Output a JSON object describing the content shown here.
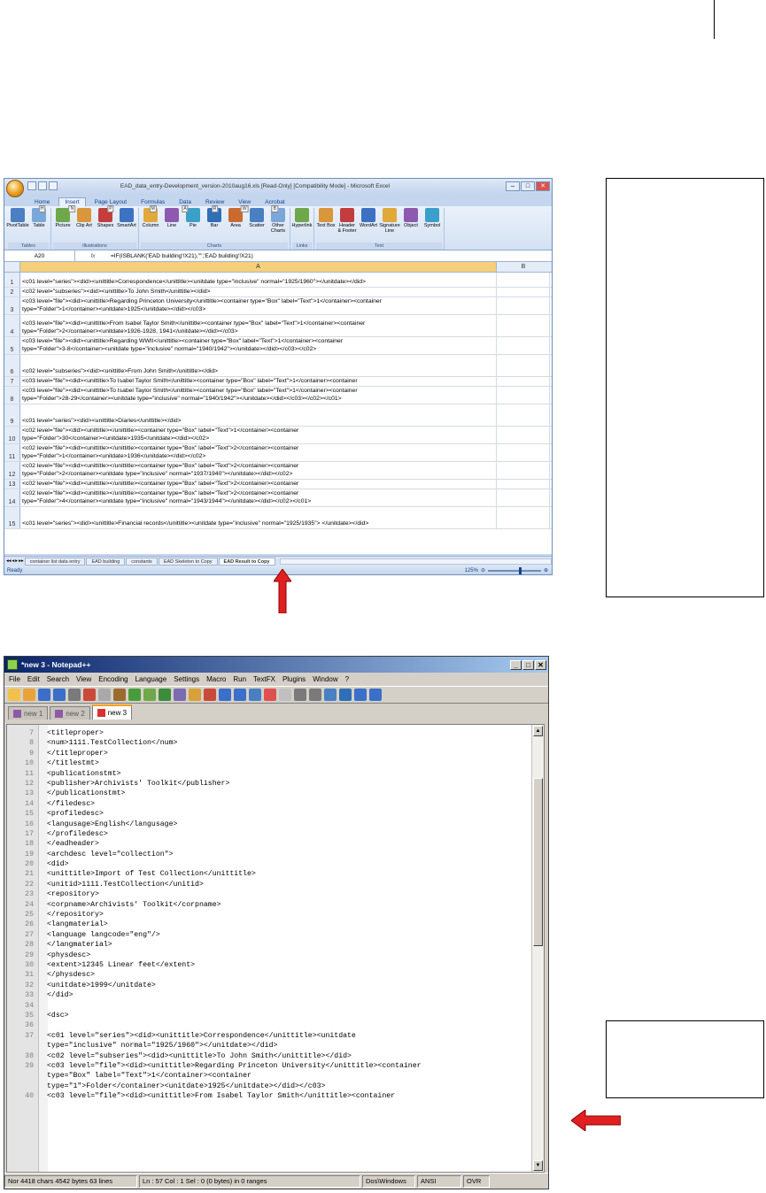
{
  "excel": {
    "window_title": "EAD_data_entry-Development_version-2010aug16.xls [Read-Only] [Compatibility Mode] - Microsoft Excel",
    "tabs": [
      {
        "label": "Home",
        "key": "H"
      },
      {
        "label": "Insert",
        "key": "N"
      },
      {
        "label": "Page Layout",
        "key": "P"
      },
      {
        "label": "Formulas",
        "key": "M"
      },
      {
        "label": "Data",
        "key": "A"
      },
      {
        "label": "Review",
        "key": "R"
      },
      {
        "label": "View",
        "key": "W"
      },
      {
        "label": "Acrobat",
        "key": "B"
      }
    ],
    "ribbon_groups": [
      {
        "label": "Tables",
        "items": [
          "PivotTable",
          "Table"
        ]
      },
      {
        "label": "Illustrations",
        "items": [
          "Picture",
          "Clip Art",
          "Shapes",
          "SmartArt"
        ]
      },
      {
        "label": "Charts",
        "items": [
          "Column",
          "Line",
          "Pie",
          "Bar",
          "Area",
          "Scatter",
          "Other Charts"
        ]
      },
      {
        "label": "Links",
        "items": [
          "Hyperlink"
        ]
      },
      {
        "label": "Text",
        "items": [
          "Text Box",
          "Header & Footer",
          "WordArt",
          "Signature Line",
          "Object",
          "Symbol"
        ]
      }
    ],
    "name_box": "A20",
    "formula": "=IF(ISBLANK('EAD building'!X21),\"\",'EAD building'!X21)",
    "col_a": "A",
    "col_b": "B",
    "rows": [
      {
        "n": "1",
        "text": "<c01 level=\"series\"><did><unittitle>Correspondence</unittitle><unitdate type=\"inclusive\" normal=\"1925/1960\"></unitdate></did>"
      },
      {
        "n": "2",
        "text": "<c02 level=\"subseries\"><did><unittitle>To John Smith</unittitle></did>"
      },
      {
        "n": "3",
        "text": "<c03 level=\"file\"><did><unittitle>Regarding Princeton University</unittitle><container type=\"Box\" label=\"Text\">1</container><container\ntype=\"Folder\">1</container><unitdate>1925</unitdate></did></c03>"
      },
      {
        "n": "4",
        "text": "<c03 level=\"file\"><did><unittitle>From Isabel Taylor Smith</unittitle><container type=\"Box\" label=\"Text\">1</container><container\ntype=\"Folder\">2</container><unitdate>1926-1928, 1941</unitdate></did></c03>"
      },
      {
        "n": "5",
        "text": "<c03 level=\"file\"><did><unittitle>Regarding WWII</unittitle><container type=\"Box\" label=\"Text\">1</container><container\ntype=\"Folder\">3-8</container><unitdate type=\"inclusive\" normal=\"1940/1942\"></unitdate></did></c03></c02>"
      },
      {
        "n": "6",
        "text": "<c02 level=\"subseries\"><did><unittitle>From John Smith</unittitle></did>"
      },
      {
        "n": "7",
        "text": "<c03 level=\"file\"><did><unittitle>To Isabel Taylor Smith</unittitle><container type=\"Box\" label=\"Text\">1</container><container"
      },
      {
        "n": "8",
        "text": "<c03 level=\"file\"><did><unittitle>To Isabel Taylor Smith</unittitle><container type=\"Box\" label=\"Text\">1</container><container\ntype=\"Folder\">28-29</container><unitdate type=\"inclusive\" normal=\"1940/1942\"></unitdate></did></c03></c02></c01>"
      },
      {
        "n": "9",
        "text": "<c01 level=\"series\"><did><unittitle>Diaries</unittitle></did>"
      },
      {
        "n": "10",
        "text": "<c02 level=\"file\"><did><unittitle></unittitle><container type=\"Box\" label=\"Text\">1</container><container\ntype=\"Folder\">30</container><unitdate>1935</unitdate></did></c02>"
      },
      {
        "n": "11",
        "text": "<c02 level=\"file\"><did><unittitle></unittitle><container type=\"Box\" label=\"Text\">2</container><container\ntype=\"Folder\">1</container><unitdate>1936</unitdate></did></c02>"
      },
      {
        "n": "12",
        "text": "<c02 level=\"file\"><did><unittitle></unittitle><container type=\"Box\" label=\"Text\">2</container><container\ntype=\"Folder\">2</container><unitdate type=\"inclusive\" normal=\"1937/1940\"></unitdate></did></c02>"
      },
      {
        "n": "13",
        "text": "<c02 level=\"file\"><did><unittitle></unittitle><container type=\"Box\" label=\"Text\">2</container><container"
      },
      {
        "n": "14",
        "text": "<c02 level=\"file\"><did><unittitle></unittitle><container type=\"Box\" label=\"Text\">2</container><container\ntype=\"Folder\">4</container><unitdate type=\"inclusive\" normal=\"1943/1944\"></unitdate></did></c02></c01>"
      },
      {
        "n": "15",
        "text": "<c01 level=\"series\"><did><unittitle>Financial records</unittitle><unitdate type=\"inclusive\" normal=\"1925/1935\"> </unitdate></did>"
      }
    ],
    "sheets": [
      "container list data entry",
      "EAD building",
      "constants",
      "EAD Skeleton to Copy",
      "EAD Result to Copy"
    ],
    "status": "Ready",
    "zoom": "125%"
  },
  "npp": {
    "title": "*new 3 - Notepad++",
    "menu": [
      "File",
      "Edit",
      "Search",
      "View",
      "Encoding",
      "Language",
      "Settings",
      "Macro",
      "Run",
      "TextFX",
      "Plugins",
      "Window",
      "?"
    ],
    "tabs": [
      "new 1",
      "new 2",
      "new 3"
    ],
    "lines": [
      {
        "n": "7",
        "code": "<titleproper>"
      },
      {
        "n": "8",
        "code": "<num>1111.TestCollection</num>"
      },
      {
        "n": "9",
        "code": "</titleproper>"
      },
      {
        "n": "10",
        "code": "</titlestmt>"
      },
      {
        "n": "11",
        "code": "<publicationstmt>"
      },
      {
        "n": "12",
        "code": "<publisher>Archivists' Toolkit</publisher>"
      },
      {
        "n": "13",
        "code": "</publicationstmt>"
      },
      {
        "n": "14",
        "code": "</filedesc>"
      },
      {
        "n": "15",
        "code": "<profiledesc>"
      },
      {
        "n": "16",
        "code": "<langusage>English</langusage>"
      },
      {
        "n": "17",
        "code": "</profiledesc>"
      },
      {
        "n": "18",
        "code": "</eadheader>"
      },
      {
        "n": "19",
        "code": "<archdesc level=\"collection\">"
      },
      {
        "n": "20",
        "code": "<did>"
      },
      {
        "n": "21",
        "code": "<unittitle>Import of Test Collection</unittitle>"
      },
      {
        "n": "22",
        "code": "<unitid>1111.TestCollection</unitid>"
      },
      {
        "n": "23",
        "code": "<repository>"
      },
      {
        "n": "24",
        "code": "<corpname>Archivists' Toolkit</corpname>"
      },
      {
        "n": "25",
        "code": "</repository>"
      },
      {
        "n": "26",
        "code": "<langmaterial>"
      },
      {
        "n": "27",
        "code": "<language langcode=\"eng\"/>"
      },
      {
        "n": "28",
        "code": "</langmaterial>"
      },
      {
        "n": "29",
        "code": "<physdesc>"
      },
      {
        "n": "30",
        "code": "<extent>12345 Linear feet</extent>"
      },
      {
        "n": "31",
        "code": "</physdesc>"
      },
      {
        "n": "32",
        "code": "<unitdate>1999</unitdate>"
      },
      {
        "n": "33",
        "code": "</did>"
      },
      {
        "n": "34",
        "code": ""
      },
      {
        "n": "35",
        "code": "<dsc>"
      },
      {
        "n": "36",
        "code": ""
      },
      {
        "n": "37",
        "code": "<c01 level=\"series\"><did><unittitle>Correspondence</unittitle><unitdate"
      },
      {
        "n": "",
        "code": "type=\"inclusive\" normal=\"1925/1960\"></unitdate></did>"
      },
      {
        "n": "38",
        "code": "<c02 level=\"subseries\"><did><unittitle>To John Smith</unittitle></did>"
      },
      {
        "n": "39",
        "code": "<c03 level=\"file\"><did><unittitle>Regarding Princeton University</unittitle><container"
      },
      {
        "n": "",
        "code": "type=\"Box\" label=\"Text\">1</container><container"
      },
      {
        "n": "",
        "code": "type=\"1\">Folder</container><unitdate>1925</unitdate></did></c03>"
      },
      {
        "n": "40",
        "code": "<c03 level=\"file\"><did><unittitle>From Isabel Taylor Smith</unittitle><container"
      }
    ],
    "status": [
      "Nor 4418 chars  4542 bytes  63 lines",
      "Ln : 57   Col : 1   Sel : 0 (0 bytes) in 0 ranges",
      "Dos\\Windows",
      "ANSI",
      "OVR"
    ]
  },
  "colors": {
    "arrow": "#e02020",
    "excel_accent": "#f5cf7a",
    "npp_title": "#0a246a"
  }
}
